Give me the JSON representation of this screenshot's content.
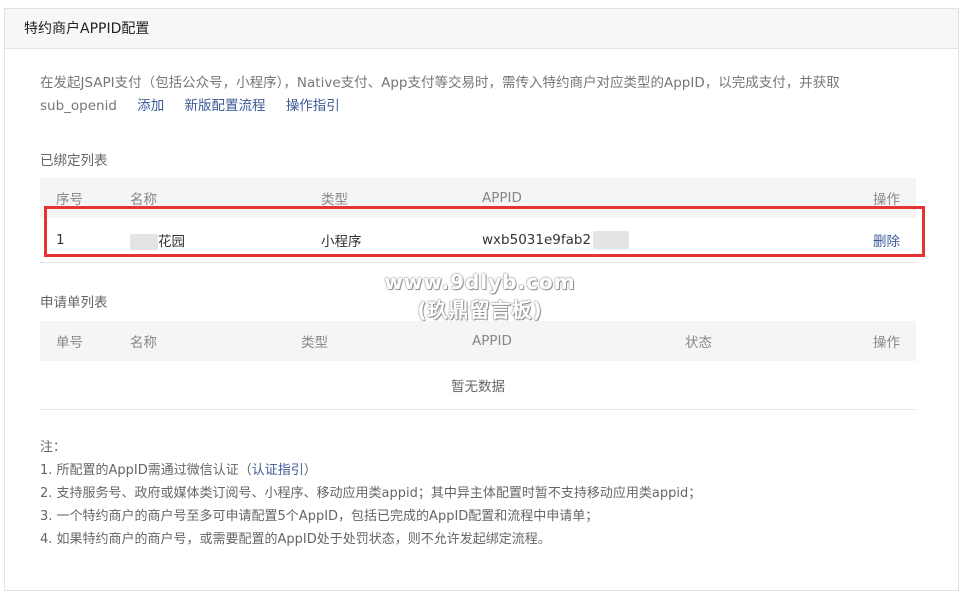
{
  "panel": {
    "title": "特约商户APPID配置"
  },
  "intro": {
    "text": "在发起JSAPI支付（包括公众号，小程序），Native支付、App支付等交易时，需传入特约商户对应类型的AppID，以完成支付，并获取sub_openid",
    "links": [
      "添加",
      "新版配置流程",
      "操作指引"
    ]
  },
  "bound": {
    "title": "已绑定列表",
    "columns": [
      "序号",
      "名称",
      "类型",
      "APPID",
      "操作"
    ],
    "rows": [
      {
        "index": "1",
        "name": "花园",
        "type": "小程序",
        "appid": "wxb5031e9fab2",
        "action": "删除"
      }
    ]
  },
  "applications": {
    "title": "申请单列表",
    "columns": [
      "单号",
      "名称",
      "类型",
      "APPID",
      "状态",
      "操作"
    ],
    "empty_text": "暂无数据"
  },
  "watermark": {
    "line1": "www.9dlyb.com",
    "line2": "(玖鼎留言板)"
  },
  "notes": {
    "label": "注：",
    "item1_prefix": "1. 所配置的AppID需通过微信认证（",
    "item1_link": "认证指引",
    "item1_suffix": "）",
    "item2": "2. 支持服务号、政府或媒体类订阅号、小程序、移动应用类appid；其中异主体配置时暂不支持移动应用类appid；",
    "item3": "3. 一个特约商户的商户号至多可申请配置5个AppID，包括已完成的AppID配置和流程中申请单；",
    "item4": "4. 如果特约商户的商户号，或需要配置的AppID处于处罚状态，则不允许发起绑定流程。"
  }
}
